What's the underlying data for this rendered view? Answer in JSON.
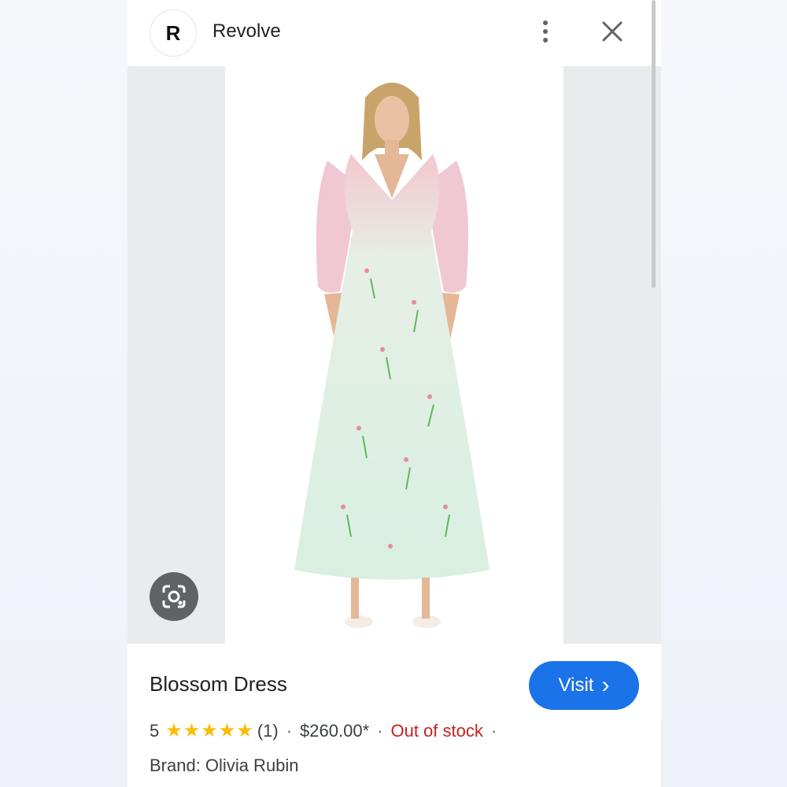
{
  "header": {
    "logo_letter": "R",
    "site_name": "Revolve",
    "more_icon": "more-vert-icon",
    "close_icon": "close-icon"
  },
  "product": {
    "title": "Blossom Dress",
    "rating_value": "5",
    "stars": "★★★★★",
    "rating_count": "(1)",
    "price": "$260.00*",
    "availability": "Out of stock",
    "brand_line": "Brand: Olivia Rubin",
    "separator": "·"
  },
  "actions": {
    "visit_label": "Visit",
    "visit_chevron": "›",
    "lens_icon": "google-lens-icon"
  },
  "colors": {
    "accent": "#1a73e8",
    "stars": "#fbbc04",
    "out_of_stock": "#c5221f"
  }
}
